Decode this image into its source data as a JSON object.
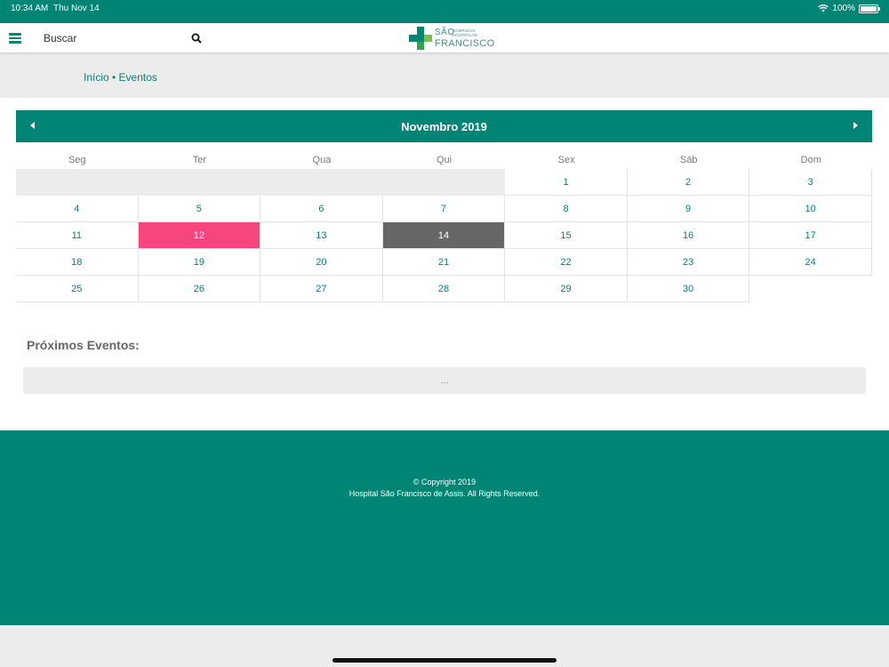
{
  "status_bar": {
    "time": "10:34 AM",
    "date": "Thu Nov 14",
    "battery": "100%"
  },
  "header": {
    "search_label": "Buscar",
    "logo": {
      "line1": "SÃO",
      "line2": "FRANCISCO",
      "small": "COMPLEXO HOSPITALAR"
    }
  },
  "breadcrumb": "Início • Eventos",
  "calendar": {
    "month_title": "Novembro 2019",
    "weekdays": [
      "Seg",
      "Ter",
      "Qua",
      "Qui",
      "Sex",
      "Sáb",
      "Dom"
    ],
    "weeks": [
      [
        "",
        "",
        "",
        "",
        "1",
        "2",
        "3"
      ],
      [
        "4",
        "5",
        "6",
        "7",
        "8",
        "9",
        "10"
      ],
      [
        "11",
        "12",
        "13",
        "14",
        "15",
        "16",
        "17"
      ],
      [
        "18",
        "19",
        "20",
        "21",
        "22",
        "23",
        "24"
      ],
      [
        "25",
        "26",
        "27",
        "28",
        "29",
        "30",
        ""
      ]
    ],
    "selected_day": "12",
    "today": "14",
    "colors": {
      "header": "#008474",
      "selected": "#f7457e",
      "today": "#666666"
    }
  },
  "events": {
    "title": "Próximos Eventos:",
    "placeholder": "..."
  },
  "footer": {
    "copyright": "© Copyright 2019",
    "rights": "Hospital São Francisco de Assis. All Rights Reserved."
  }
}
